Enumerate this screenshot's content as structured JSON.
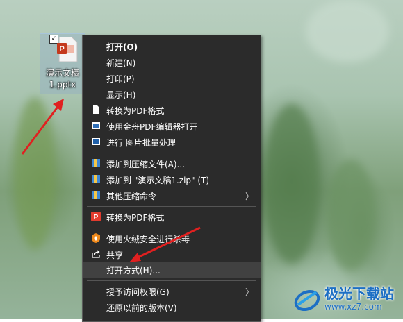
{
  "desktop": {
    "file": {
      "checked": "✓",
      "name_line1": "演示文稿",
      "name_line2": "1.pptx"
    }
  },
  "context_menu": {
    "items": [
      {
        "label": "打开(O)",
        "bold": true
      },
      {
        "label": "新建(N)"
      },
      {
        "label": "打印(P)"
      },
      {
        "label": "显示(H)"
      },
      {
        "label": "转换为PDF格式",
        "icon": "document-icon"
      },
      {
        "label": "使用金舟PDF编辑器打开",
        "icon": "pdf-editor-icon"
      },
      {
        "label": "进行 图片批量处理",
        "icon": "image-batch-icon"
      },
      {
        "label": "添加到压缩文件(A)...",
        "icon": "archive-icon"
      },
      {
        "label": "添加到 \"演示文稿1.zip\" (T)",
        "icon": "archive-icon"
      },
      {
        "label": "其他压缩命令",
        "icon": "archive-icon",
        "submenu": true
      },
      {
        "label": "转换为PDF格式",
        "icon": "wps-pdf-icon"
      },
      {
        "label": "使用火绒安全进行杀毒",
        "icon": "huorong-shield-icon"
      },
      {
        "label": "共享",
        "icon": "share-icon"
      },
      {
        "label": "打开方式(H)...",
        "highlighted": true
      },
      {
        "label": "授予访问权限(G)",
        "submenu": true
      },
      {
        "label": "还原以前的版本(V)"
      }
    ],
    "submenu_chevron": "〉"
  },
  "watermark": {
    "brand": "极光下载站",
    "url": "www.xz7.com"
  },
  "colors": {
    "menu_bg": "#2b2b2b",
    "menu_highlight": "#414141",
    "arrow_red": "#e02020",
    "watermark_blue": "#1d6fc4"
  }
}
